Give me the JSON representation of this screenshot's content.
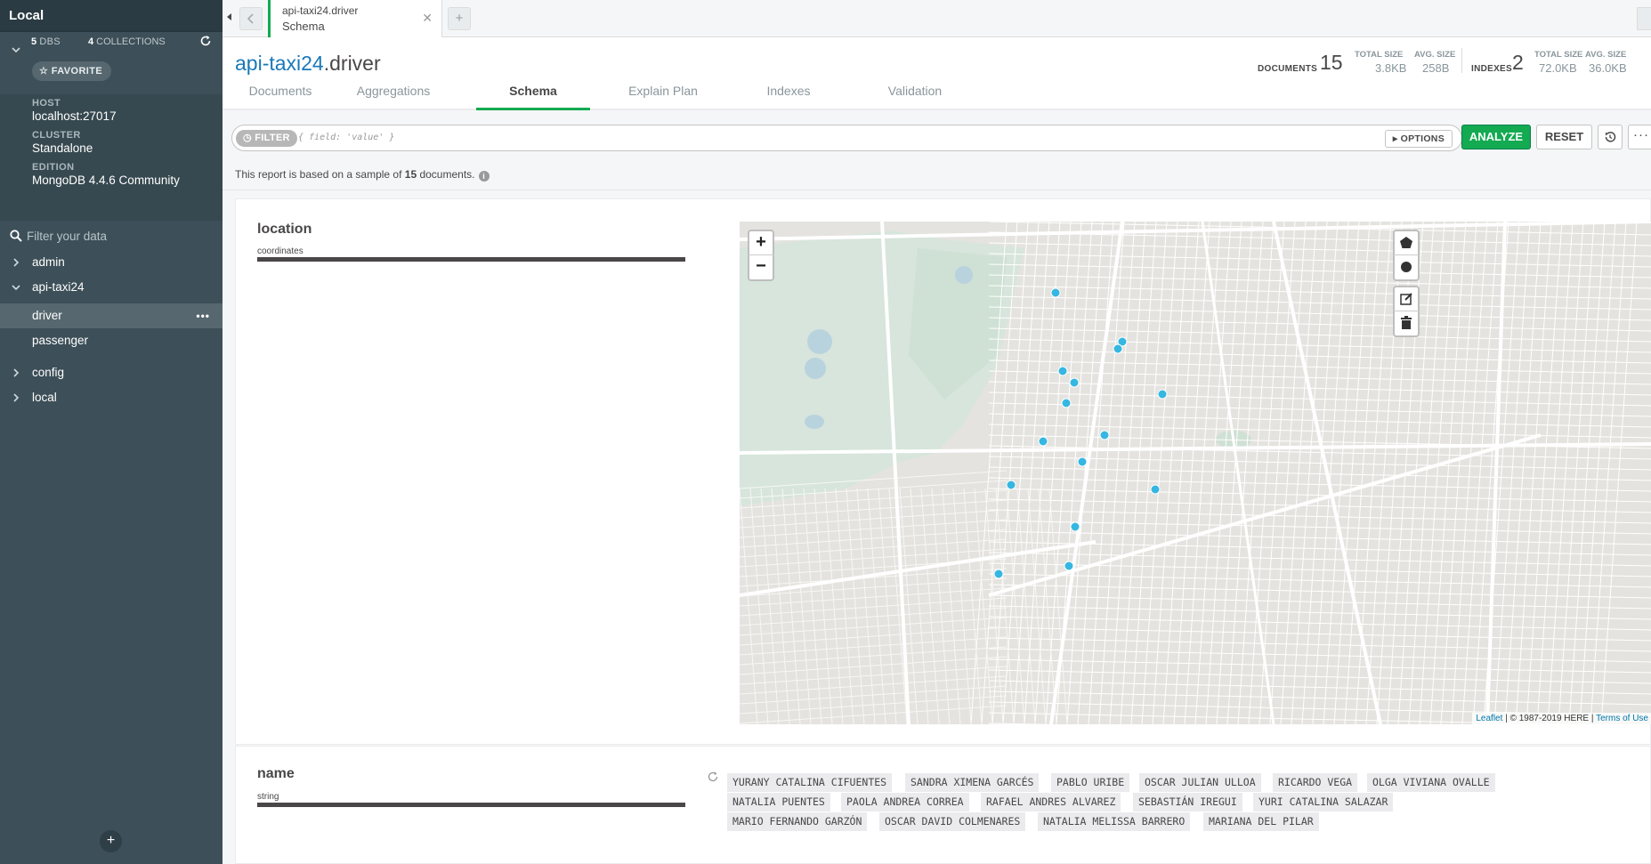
{
  "sidebar": {
    "title": "Local",
    "dbs_count": "5",
    "dbs_label": "DBS",
    "collections_count": "4",
    "collections_label": "COLLECTIONS",
    "favorite_label": "FAVORITE",
    "host_label": "HOST",
    "host_value": "localhost:27017",
    "cluster_label": "CLUSTER",
    "cluster_value": "Standalone",
    "edition_label": "EDITION",
    "edition_value": "MongoDB 4.4.6 Community",
    "filter_placeholder": "Filter your data",
    "databases": [
      {
        "name": "admin",
        "expanded": false
      },
      {
        "name": "api-taxi24",
        "expanded": true,
        "collections": [
          "driver",
          "passenger"
        ]
      },
      {
        "name": "config",
        "expanded": false
      },
      {
        "name": "local",
        "expanded": false
      }
    ],
    "active_collection": "driver",
    "add_label": "+"
  },
  "tabbar": {
    "tab_namespace": "api-taxi24.driver",
    "tab_subtitle": "Schema",
    "new_tab_label": "+"
  },
  "header": {
    "db": "api-taxi24",
    "collection": ".driver",
    "documents_label": "DOCUMENTS",
    "documents_value": "15",
    "doc_total_size_label": "TOTAL SIZE",
    "doc_total_size": "3.8KB",
    "doc_avg_size_label": "AVG. SIZE",
    "doc_avg_size": "258B",
    "indexes_label": "INDEXES",
    "indexes_value": "2",
    "idx_total_size_label": "TOTAL SIZE",
    "idx_total_size": "72.0KB",
    "idx_avg_size_label": "AVG. SIZE",
    "idx_avg_size": "36.0KB",
    "tabs": [
      "Documents",
      "Aggregations",
      "Schema",
      "Explain Plan",
      "Indexes",
      "Validation"
    ],
    "selected_tab": "Schema"
  },
  "toolbar": {
    "filter_label": "FILTER",
    "filter_placeholder": "{ field: 'value' }",
    "options_label": "OPTIONS",
    "analyze_label": "ANALYZE",
    "reset_label": "RESET",
    "more_label": "···"
  },
  "sample": {
    "prefix": "This report is based on a sample of ",
    "count": "15",
    "suffix": " documents."
  },
  "fields": [
    {
      "name": "location",
      "type": "coordinates",
      "map": {
        "zoom_in": "+",
        "zoom_out": "−",
        "attribution_leaflet": "Leaflet",
        "attribution_here": "| © 1987-2019 HERE |",
        "attribution_terms": "Terms of Use",
        "marker_color": "#36b7e1",
        "markers": 15
      }
    },
    {
      "name": "name",
      "type": "string",
      "values": [
        "YURANY CATALINA CIFUENTES",
        "SANDRA XIMENA GARCÉS",
        "PABLO URIBE",
        "OSCAR JULIAN ULLOA",
        "RICARDO VEGA",
        "OLGA VIVIANA OVALLE",
        "NATALIA PUENTES",
        "PAOLA ANDREA CORREA",
        "RAFAEL ANDRES ALVAREZ",
        "SEBASTIÁN IREGUI",
        "YURI CATALINA SALAZAR",
        "MARIO FERNANDO GARZÓN",
        "OSCAR DAVID COLMENARES",
        "NATALIA MELISSA BARRERO",
        "MARIANA DEL PILAR"
      ]
    }
  ],
  "colors": {
    "sidebar_bg": "#3d4f58",
    "accent_green": "#13aa52",
    "link_blue": "#1a79b8"
  }
}
